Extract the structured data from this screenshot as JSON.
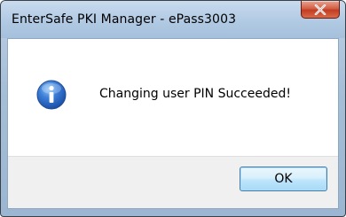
{
  "window": {
    "title": "EnterSafe PKI Manager - ePass3003"
  },
  "message": {
    "icon": "info-icon",
    "text": "Changing user PIN Succeeded!"
  },
  "buttons": {
    "ok_label": "OK"
  },
  "colors": {
    "close_button": "#c94a30",
    "info_icon": "#2f6fcf",
    "button_border": "#3c7fb1"
  }
}
